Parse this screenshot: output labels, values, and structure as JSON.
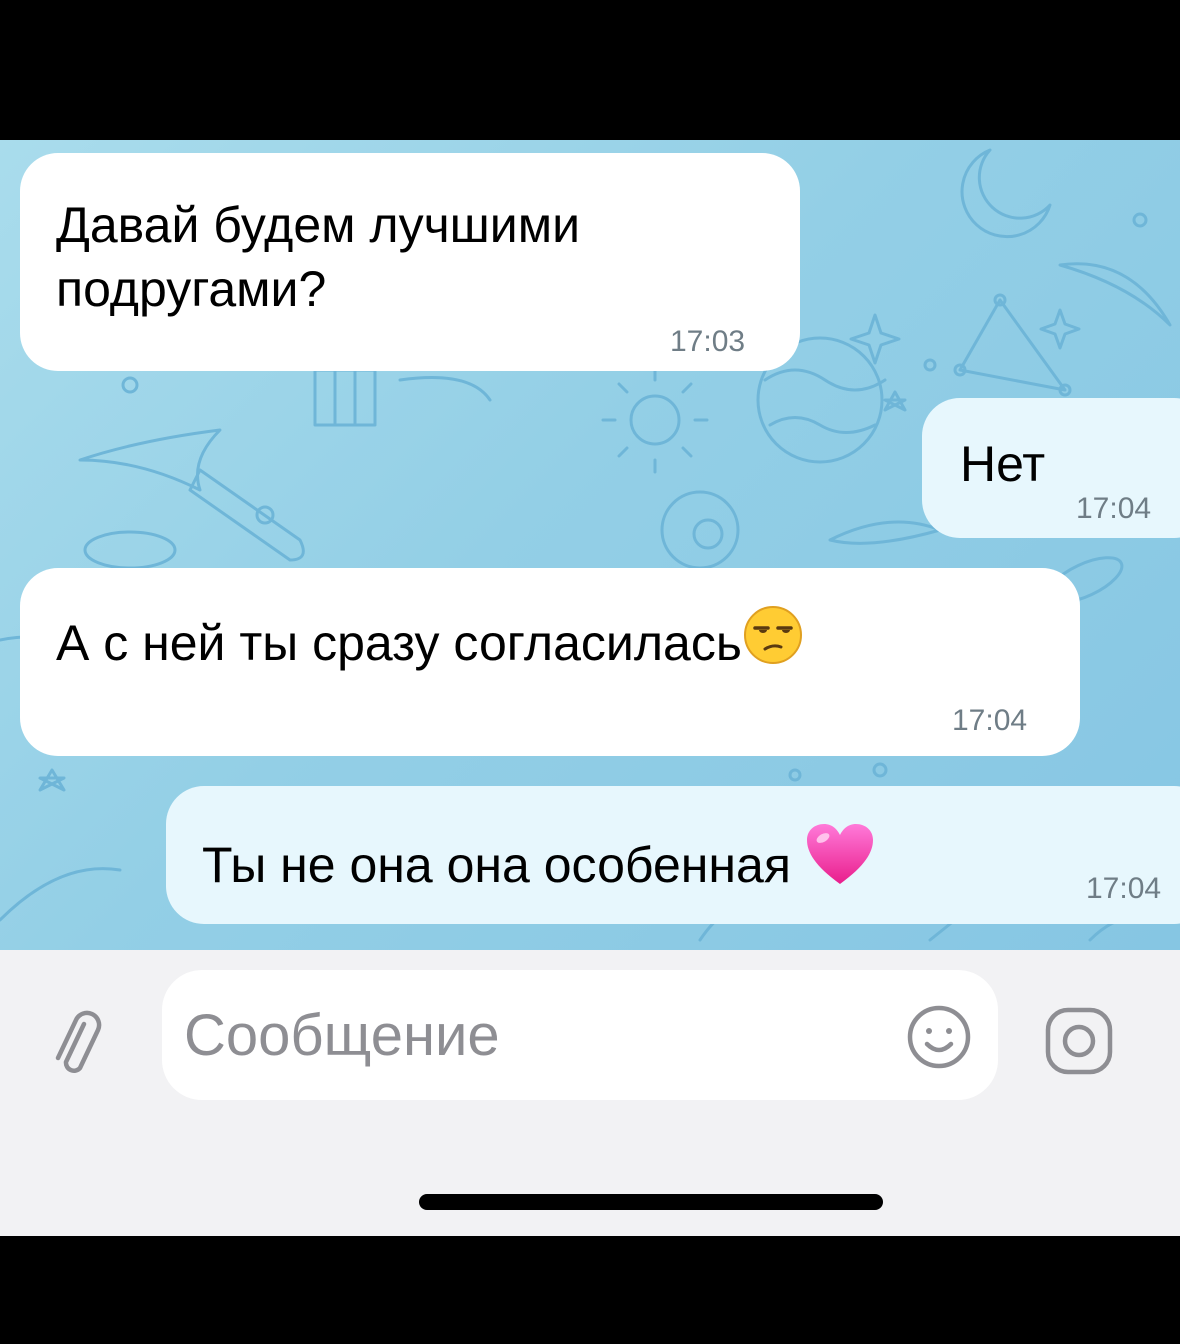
{
  "messages": [
    {
      "direction": "incoming",
      "text": "Давай будем лучшими\nподругами?",
      "time": "17:03"
    },
    {
      "direction": "outgoing",
      "text": "Нет",
      "time": "17:04"
    },
    {
      "direction": "incoming",
      "text": "А с ней ты сразу согласилась",
      "emoji": "unamused-face-emoji",
      "time": "17:04"
    },
    {
      "direction": "outgoing",
      "text": "Ты не она она особенная",
      "emoji": "pink-heart-emoji",
      "time": "17:04"
    }
  ],
  "composer": {
    "placeholder": "Сообщение",
    "attach_icon": "paperclip-icon",
    "sticker_icon": "smiley-icon",
    "camera_icon": "camera-icon"
  },
  "colors": {
    "wallpaper": "#93cfe6",
    "incoming_bubble": "#ffffff",
    "outgoing_bubble": "#e7f7fd",
    "time_text": "#6f7d86",
    "composer_bg": "#f2f2f4"
  }
}
